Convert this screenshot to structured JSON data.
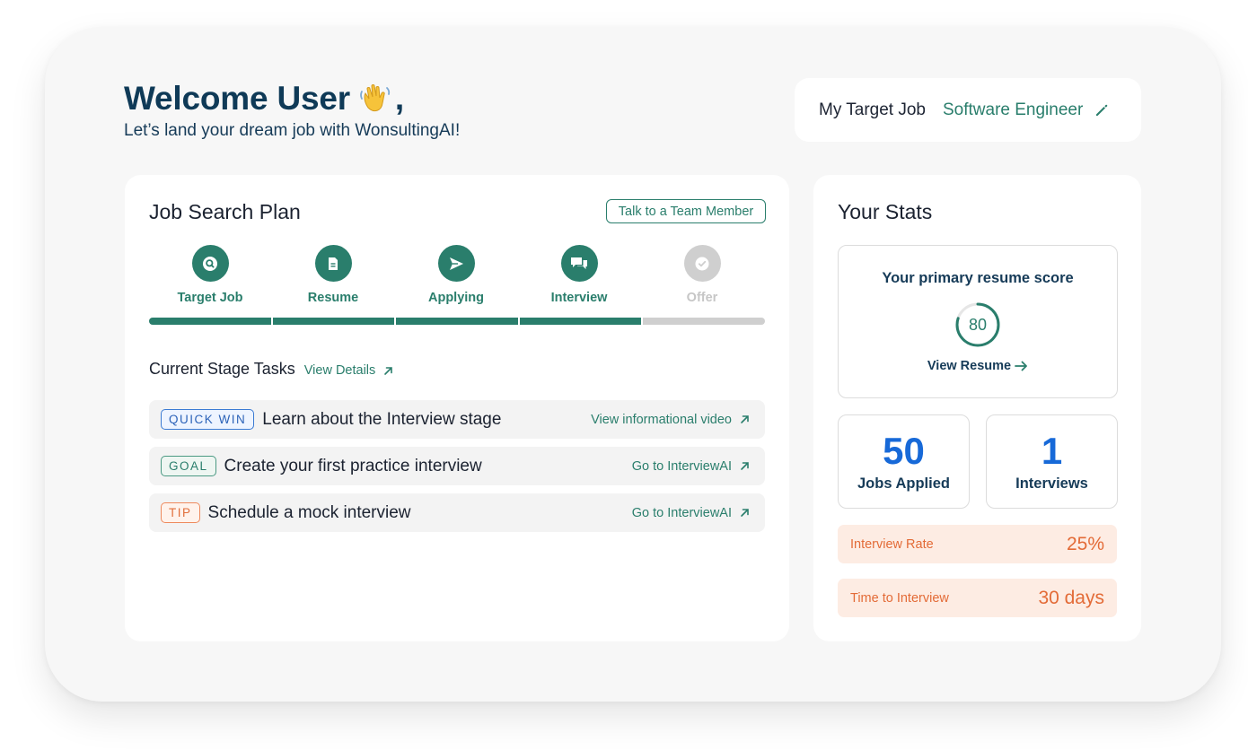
{
  "header": {
    "welcome_title": "Welcome User",
    "welcome_emoji": "waving-hand-icon",
    "welcome_comma": ",",
    "subtitle": "Let’s land your dream job with WonsultingAI!"
  },
  "target_job": {
    "label": "My Target Job",
    "value": "Software Engineer",
    "edit_icon": "pencil-icon"
  },
  "plan": {
    "title": "Job Search Plan",
    "talk_button": "Talk to a Team Member",
    "steps": [
      {
        "label": "Target Job",
        "icon": "search-icon",
        "active": true
      },
      {
        "label": "Resume",
        "icon": "document-icon",
        "active": true
      },
      {
        "label": "Applying",
        "icon": "send-icon",
        "active": true
      },
      {
        "label": "Interview",
        "icon": "chat-bubbles-icon",
        "active": true
      },
      {
        "label": "Offer",
        "icon": "check-badge-icon",
        "active": false
      }
    ],
    "progress_completed_segments": 4,
    "progress_total_segments": 5,
    "tasks_title": "Current Stage Tasks",
    "view_details": "View Details",
    "tasks": [
      {
        "badge": "QUICK WIN",
        "text": "Learn about the Interview stage",
        "link": "View informational video"
      },
      {
        "badge": "GOAL",
        "text": "Create your first practice interview",
        "link": "Go to InterviewAI"
      },
      {
        "badge": "TIP",
        "text": "Schedule a mock interview",
        "link": "Go to InterviewAI"
      }
    ]
  },
  "stats": {
    "title": "Your Stats",
    "score_label": "Your primary resume score",
    "score_value": "80",
    "score_fraction": 0.8,
    "view_resume": "View Resume",
    "jobs_applied_value": "50",
    "jobs_applied_label": "Jobs Applied",
    "interviews_value": "1",
    "interviews_label": "Interviews",
    "interview_rate_label": "Interview Rate",
    "interview_rate_value": "25%",
    "time_to_interview_label": "Time to Interview",
    "time_to_interview_value": "30 days"
  },
  "colors": {
    "accent_green": "#2a7e6c",
    "navy_text": "#163b58",
    "blue_number": "#1769d8",
    "orange": "#e36b37",
    "inactive_gray": "#cfcfcf"
  }
}
